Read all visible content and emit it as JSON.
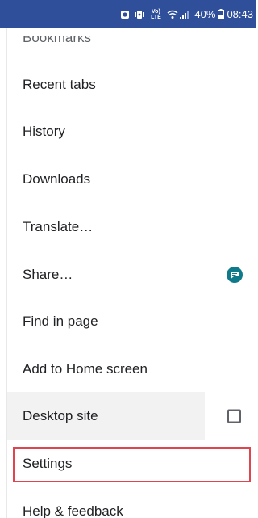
{
  "status_bar": {
    "signal_label": "Vo) LTE",
    "battery": "40%",
    "time": "08:43",
    "icons": [
      "alarm-icon",
      "vibrate-icon",
      "volte-icon",
      "wifi-icon",
      "signal-icon",
      "battery-icon"
    ],
    "background": "#2f4f9b"
  },
  "menu": {
    "cut_item": "Bookmarks",
    "items": [
      {
        "label": "Recent tabs"
      },
      {
        "label": "History"
      },
      {
        "label": "Downloads"
      },
      {
        "label": "Translate…"
      },
      {
        "label": "Share…",
        "trailing_icon": "chat-bubble-icon"
      },
      {
        "label": "Find in page"
      },
      {
        "label": "Add to Home screen"
      },
      {
        "label": "Desktop site",
        "trailing": "checkbox",
        "checked": false
      },
      {
        "label": "Settings",
        "highlighted": true
      },
      {
        "label": "Help & feedback"
      }
    ]
  },
  "colors": {
    "text": "#202124",
    "highlight_border": "#e0454f",
    "desktop_row_bg": "#f2f2f2",
    "share_badge": "#0f7b8a"
  }
}
